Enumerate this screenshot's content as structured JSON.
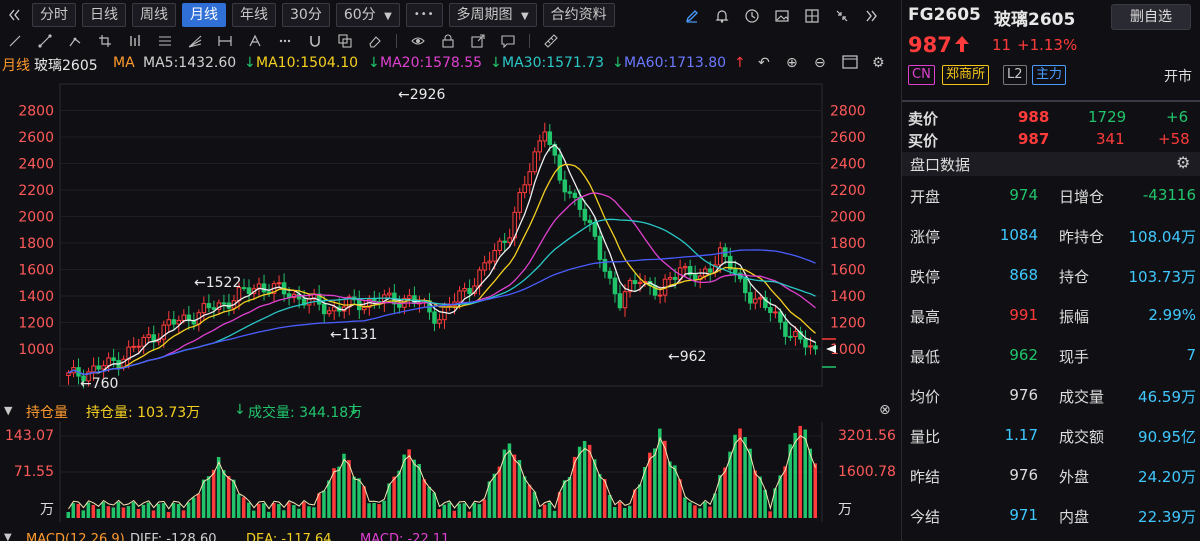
{
  "toolbar": {
    "back_icon": "double-chevron-left-icon",
    "periods": [
      "分时",
      "日线",
      "周线",
      "月线",
      "年线",
      "30分",
      "60分"
    ],
    "active_period": "月线",
    "more_label": "•••",
    "multi_period_label": "多周期图",
    "contract_info_label": "合约资料",
    "right_icons": [
      "pen-icon",
      "bell-icon",
      "clock-icon",
      "image-icon",
      "grid-icon",
      "shrink-icon",
      "chevron-right-icon"
    ]
  },
  "drawing_tools": [
    "line-icon",
    "ray-icon",
    "segment-icon",
    "crop-icon",
    "bar-icon",
    "parallel-icon",
    "fan-icon",
    "measure-icon",
    "text-icon",
    "more-dots-icon",
    "magnet-icon",
    "layers-icon",
    "eraser-icon",
    "eye-icon",
    "lock-icon",
    "share-icon",
    "comment-icon",
    "ruler-icon"
  ],
  "ma_legend": {
    "period_label": "月线",
    "name": "玻璃2605",
    "ma_label": "MA",
    "ma5": "MA5:1432.60",
    "ma10": "MA10:1504.10",
    "ma20": "MA20:1578.55",
    "ma30": "MA30:1571.73",
    "ma60": "MA60:1713.80"
  },
  "price_axis": {
    "ticks": [
      "2800",
      "2600",
      "2400",
      "2200",
      "2000",
      "1800",
      "1600",
      "1400",
      "1200",
      "1000"
    ],
    "annotations": {
      "high": "←2926",
      "peak_left": "←1522",
      "low_mid": "←1131",
      "low_start": "←760",
      "last": "←962"
    }
  },
  "volume_panel": {
    "collapse_icon": "triangle-down-icon",
    "indicator": "持仓量",
    "oi_label": "持仓量: 103.73万",
    "vol_label": "成交量: 344.18万",
    "left_ticks": [
      "143.07",
      "71.55",
      "万"
    ],
    "right_ticks": [
      "3201.56",
      "1600.78",
      "万"
    ],
    "close_icon": "close-circle-icon"
  },
  "macd_legend": {
    "label": "MACD(12,26,9)",
    "diff": "DIFF: -128.60",
    "dea": "DEA: -117.64",
    "macd": "MACD: -22.11"
  },
  "quote": {
    "code": "FG2605",
    "name": "玻璃2605",
    "delete_fav_label": "删自选",
    "last": "987",
    "change": "11",
    "change_pct": "+1.13%",
    "tags": [
      "CN",
      "郑商所",
      "L2",
      "主力"
    ],
    "status": "开市",
    "ask": {
      "label": "卖价",
      "price": "988",
      "vol": "1729",
      "delta": "+6"
    },
    "bid": {
      "label": "买价",
      "price": "987",
      "vol": "341",
      "delta": "+58"
    },
    "panel_title": "盘口数据",
    "settings_icon": "gear-icon",
    "rows": [
      {
        "l1": "开盘",
        "v1": "974",
        "l2": "日增仓",
        "v2": "-43116"
      },
      {
        "l1": "涨停",
        "v1": "1084",
        "l2": "昨持仓",
        "v2": "108.04万"
      },
      {
        "l1": "跌停",
        "v1": "868",
        "l2": "持仓",
        "v2": "103.73万"
      },
      {
        "l1": "最高",
        "v1": "991",
        "l2": "振幅",
        "v2": "2.99%"
      },
      {
        "l1": "最低",
        "v1": "962",
        "l2": "现手",
        "v2": "7"
      },
      {
        "l1": "均价",
        "v1": "976",
        "l2": "成交量",
        "v2": "46.59万"
      },
      {
        "l1": "量比",
        "v1": "1.17",
        "l2": "成交额",
        "v2": "90.95亿"
      },
      {
        "l1": "昨结",
        "v1": "976",
        "l2": "外盘",
        "v2": "24.20万"
      },
      {
        "l1": "今结",
        "v1": "971",
        "l2": "内盘",
        "v2": "22.39万"
      }
    ]
  },
  "colors": {
    "up": "#ff3b3b",
    "down": "#21c46b",
    "ma5": "#f0f0f0",
    "ma10": "#f5d020",
    "ma20": "#e040d0",
    "ma30": "#2bc8c8",
    "ma60": "#4a5cff",
    "accent": "#2f6fd6",
    "value_cyan": "#3fc8ff",
    "value_green": "#21c46b"
  }
}
